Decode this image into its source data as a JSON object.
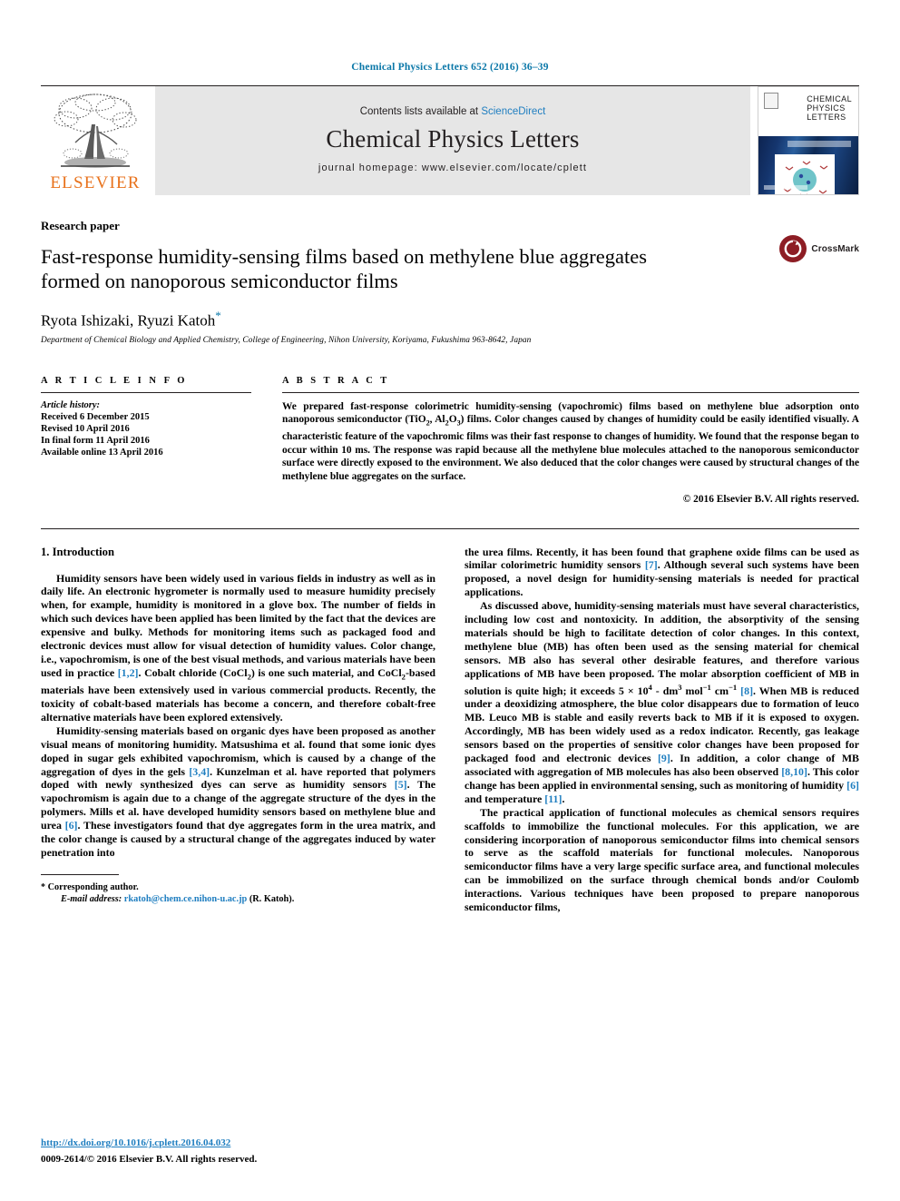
{
  "running_head": "Chemical Physics Letters 652 (2016) 36–39",
  "masthead": {
    "contents_prefix": "Contents lists available at ",
    "sciencedirect": "ScienceDirect",
    "journal_name": "Chemical Physics Letters",
    "homepage": "journal homepage: www.elsevier.com/locate/cplett",
    "publisher": "ELSEVIER",
    "cover_title": "CHEMICAL\nPHYSICS\nLETTERS"
  },
  "article": {
    "type": "Research paper",
    "title": "Fast-response humidity-sensing films based on methylene blue aggregates formed on nanoporous semiconductor films",
    "authors": "Ryota Ishizaki, Ryuzi Katoh",
    "author_marker": "*",
    "affiliation": "Department of Chemical Biology and Applied Chemistry, College of Engineering, Nihon University, Koriyama, Fukushima 963-8642, Japan",
    "crossmark_label": "CrossMark"
  },
  "info": {
    "label": "A R T I C L E   I N F O",
    "history_title": "Article history:",
    "history": [
      "Received 6 December 2015",
      "Revised 10 April 2016",
      "In final form 11 April 2016",
      "Available online 13 April 2016"
    ]
  },
  "abstract": {
    "label": "A B S T R A C T",
    "copyright": "© 2016 Elsevier B.V. All rights reserved."
  },
  "body": {
    "section1_title": "1. Introduction",
    "footnote_corresponding": "Corresponding author.",
    "footnote_email_label": "E-mail address:",
    "footnote_email": "rkatoh@chem.ce.nihon-u.ac.jp",
    "footnote_email_suffix": "(R. Katoh).",
    "doi": "http://dx.doi.org/10.1016/j.cplett.2016.04.032",
    "issn_line": "0009-2614/© 2016 Elsevier B.V. All rights reserved."
  },
  "colors": {
    "link_blue": "#1f7ec0",
    "runhead_blue": "#0a77a8",
    "elsevier_orange": "#e8721c",
    "crossmark_red": "#8d1d24",
    "band_gray": "#e6e6e6"
  }
}
